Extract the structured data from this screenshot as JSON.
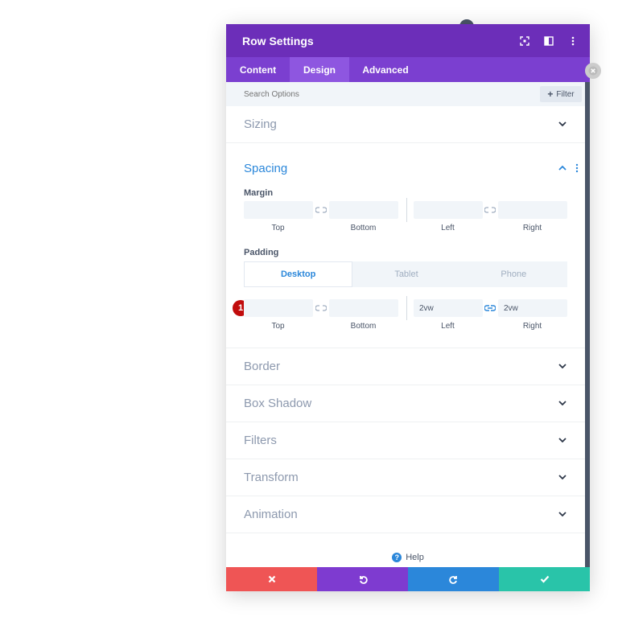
{
  "modal": {
    "title": "Row Settings",
    "tabs": [
      {
        "label": "Content",
        "active": false
      },
      {
        "label": "Design",
        "active": true
      },
      {
        "label": "Advanced",
        "active": false
      }
    ]
  },
  "search": {
    "placeholder": "Search Options",
    "filter_label": "Filter"
  },
  "sections": {
    "sizing": "Sizing",
    "spacing": "Spacing",
    "border": "Border",
    "box_shadow": "Box Shadow",
    "filters": "Filters",
    "transform": "Transform",
    "animation": "Animation"
  },
  "margin": {
    "label": "Margin",
    "top": "",
    "bottom": "",
    "left": "",
    "right": "",
    "captions": {
      "top": "Top",
      "bottom": "Bottom",
      "left": "Left",
      "right": "Right"
    }
  },
  "padding": {
    "label": "Padding",
    "devices": [
      "Desktop",
      "Tablet",
      "Phone"
    ],
    "active_device": "Desktop",
    "top": "",
    "bottom": "",
    "left": "2vw",
    "right": "2vw",
    "captions": {
      "top": "Top",
      "bottom": "Bottom",
      "left": "Left",
      "right": "Right"
    }
  },
  "badge": "1",
  "help_label": "Help",
  "colors": {
    "header": "#6c2eb9",
    "tabs": "#7b3fd0",
    "accent_blue": "#2b87da",
    "cancel": "#ef5555",
    "undo": "#7e3bd0",
    "redo": "#2b87da",
    "save": "#29c4a9"
  },
  "icons": {
    "footer": [
      "close-icon",
      "undo-icon",
      "redo-icon",
      "check-icon"
    ]
  }
}
